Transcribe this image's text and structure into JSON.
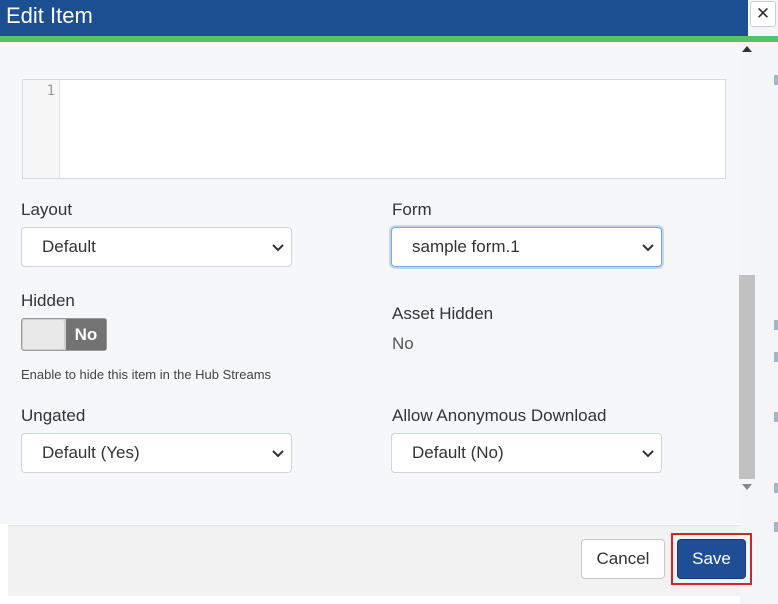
{
  "dialog": {
    "title": "Edit Item",
    "close_icon": "close-icon"
  },
  "editor": {
    "line_numbers": [
      "1"
    ]
  },
  "fields": {
    "layout": {
      "label": "Layout",
      "value": "Default"
    },
    "form": {
      "label": "Form",
      "value": "sample form.1"
    },
    "hidden": {
      "label": "Hidden",
      "toggle_state": "No",
      "help": "Enable to hide this item in the Hub Streams"
    },
    "asset_hidden": {
      "label": "Asset Hidden",
      "value": "No"
    },
    "ungated": {
      "label": "Ungated",
      "value": "Default (Yes)"
    },
    "anonymous_download": {
      "label": "Allow Anonymous Download",
      "value": "Default (No)"
    }
  },
  "footer": {
    "cancel_label": "Cancel",
    "save_label": "Save"
  },
  "colors": {
    "header_bg": "#1c4f91",
    "header_accent": "#4fc46b",
    "save_bg": "#1f4e96",
    "highlight": "#d4232a"
  }
}
